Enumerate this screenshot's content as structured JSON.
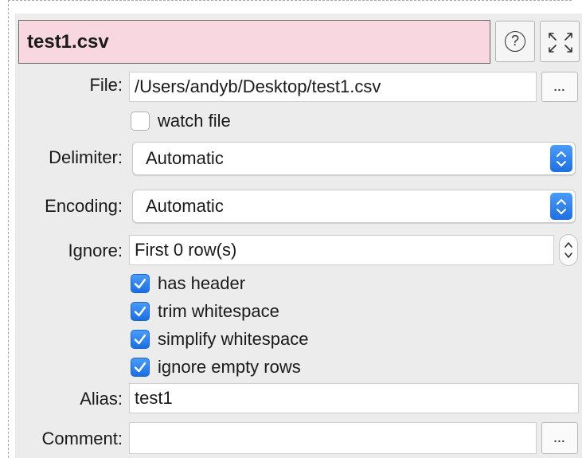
{
  "title": "test1.csv",
  "icons": {
    "help": "help-circle-icon",
    "maximize": "expand-arrows-icon",
    "browse": "ellipsis-icon",
    "select": "up-down-chevron-icon",
    "checkmark": "checkmark-icon"
  },
  "colors": {
    "title_bg": "#f8d7e0",
    "accent": "#2a7df0",
    "panel_bg": "#ececec"
  },
  "form": {
    "file": {
      "label": "File:",
      "value": "/Users/andyb/Desktop/test1.csv",
      "browse_label": "..."
    },
    "watch_file": {
      "label": "watch file",
      "checked": false
    },
    "delimiter": {
      "label": "Delimiter:",
      "value": "Automatic"
    },
    "encoding": {
      "label": "Encoding:",
      "value": "Automatic"
    },
    "ignore": {
      "label": "Ignore:",
      "value": "First 0 row(s)"
    },
    "options": [
      {
        "label": "has header",
        "checked": true
      },
      {
        "label": "trim whitespace",
        "checked": true
      },
      {
        "label": "simplify whitespace",
        "checked": true
      },
      {
        "label": "ignore empty rows",
        "checked": true
      }
    ],
    "alias": {
      "label": "Alias:",
      "value": "test1"
    },
    "comment": {
      "label": "Comment:",
      "value": "",
      "browse_label": "..."
    }
  }
}
